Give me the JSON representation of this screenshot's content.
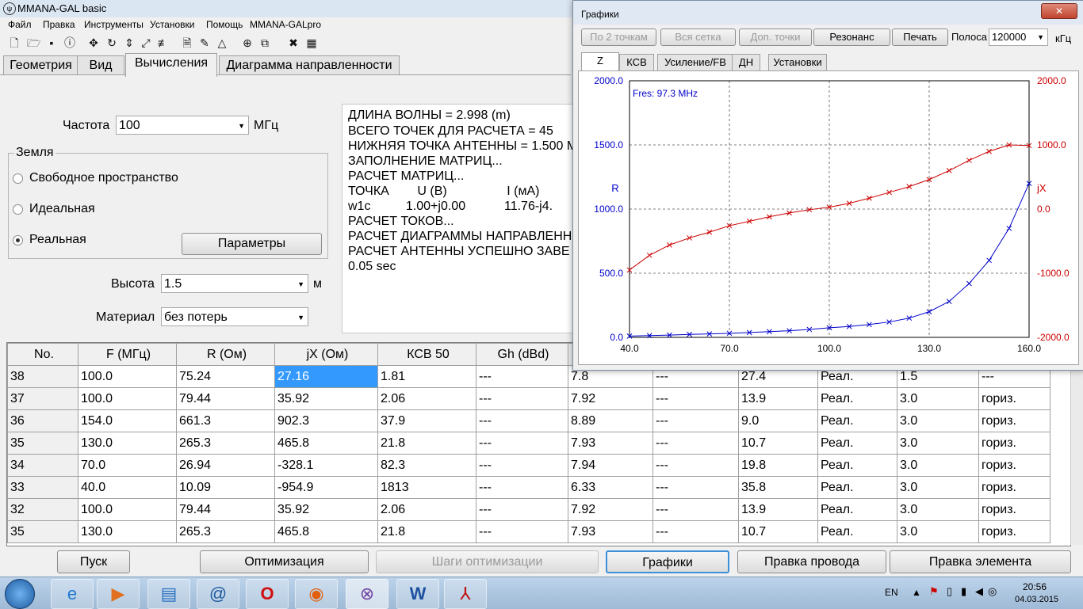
{
  "main_window": {
    "title": "MMANA-GAL basic",
    "menu": [
      "Файл",
      "Правка",
      "Инструменты",
      "Установки",
      "Помощь",
      "MMANA-GALpro"
    ],
    "tabs": [
      "Геометрия",
      "Вид",
      "Вычисления",
      "Диаграмма направленности"
    ],
    "active_tab": "Вычисления"
  },
  "form": {
    "freq_label": "Частота",
    "freq_value": "100",
    "freq_unit": "МГц",
    "ground_label": "Земля",
    "ground_options": [
      "Свободное пространство",
      "Идеальная",
      "Реальная"
    ],
    "ground_selected": "Реальная",
    "params_button": "Параметры",
    "height_label": "Высота",
    "height_value": "1.5",
    "height_unit": "м",
    "material_label": "Материал",
    "material_value": "без потерь"
  },
  "log_lines": [
    "ДЛИНА ВОЛНЫ = 2.998 (m)",
    "ВСЕГО ТОЧЕК ДЛЯ РАСЧЕТА = 45",
    "НИЖНЯЯ ТОЧКА АНТЕННЫ = 1.500 M",
    "ЗАПОЛНЕНИЕ МАТРИЦ...",
    "РАСЧЕТ МАТРИЦ...",
    "ТОЧКА        U (B)                 I (мА)",
    "w1c          1.00+j0.00           11.76-j4.",
    "РАСЧЕТ ТОКОВ...",
    "РАСЧЕТ ДИАГРАММЫ НАПРАВЛЕНН",
    "РАСЧЕТ АНТЕННЫ УСПЕШНО ЗАВЕ",
    "0.05 sec"
  ],
  "table": {
    "columns": [
      "No.",
      "F (МГц)",
      "R (Ом)",
      "jX (Ом)",
      "КСВ 50",
      "Gh (dBd)",
      "",
      "",
      "",
      "",
      "",
      ""
    ],
    "rows": [
      [
        "38",
        "100.0",
        "75.24",
        "27.16",
        "1.81",
        "---",
        "7.8",
        "---",
        "27.4",
        "Реал.",
        "1.5",
        "---"
      ],
      [
        "37",
        "100.0",
        "79.44",
        "35.92",
        "2.06",
        "---",
        "7.92",
        "---",
        "13.9",
        "Реал.",
        "3.0",
        "гориз."
      ],
      [
        "36",
        "154.0",
        "661.3",
        "902.3",
        "37.9",
        "---",
        "8.89",
        "---",
        "9.0",
        "Реал.",
        "3.0",
        "гориз."
      ],
      [
        "35",
        "130.0",
        "265.3",
        "465.8",
        "21.8",
        "---",
        "7.93",
        "---",
        "10.7",
        "Реал.",
        "3.0",
        "гориз."
      ],
      [
        "34",
        "70.0",
        "26.94",
        "-328.1",
        "82.3",
        "---",
        "7.94",
        "---",
        "19.8",
        "Реал.",
        "3.0",
        "гориз."
      ],
      [
        "33",
        "40.0",
        "10.09",
        "-954.9",
        "1813",
        "---",
        "6.33",
        "---",
        "35.8",
        "Реал.",
        "3.0",
        "гориз."
      ],
      [
        "32",
        "100.0",
        "79.44",
        "35.92",
        "2.06",
        "---",
        "7.92",
        "---",
        "13.9",
        "Реал.",
        "3.0",
        "гориз."
      ],
      [
        "35",
        "130.0",
        "265.3",
        "465.8",
        "21.8",
        "---",
        "7.93",
        "---",
        "10.7",
        "Реал.",
        "3.0",
        "гориз."
      ]
    ]
  },
  "bottom_buttons": [
    "Пуск",
    "Оптимизация",
    "Шаги оптимизации",
    "Графики",
    "Правка провода",
    "Правка элемента"
  ],
  "graph_window": {
    "title": "Графики",
    "close_glyph": "✕",
    "buttons": [
      "По 2 точкам",
      "Вся сетка",
      "Доп. точки",
      "Резонанс",
      "Печать"
    ],
    "band_label": "Полоса",
    "band_value": "120000",
    "band_unit": "кГц",
    "tabs": [
      "Z",
      "КСВ",
      "Усиление/FB",
      "ДН",
      "Установки"
    ],
    "active_tab": "Z"
  },
  "chart_data": {
    "type": "line",
    "annotation": "Fres: 97.3 MHz",
    "left_axis_label": "R",
    "right_axis_label": "jX",
    "x_ticks": [
      "40.0",
      "70.0",
      "100.0",
      "130.0",
      "160.0"
    ],
    "left_ticks": [
      "2000.0",
      "1500.0",
      "1000.0",
      "500.0",
      "0.0"
    ],
    "right_ticks": [
      "2000.0",
      "1000.0",
      "0.0",
      "-1000.0",
      "-2000.0"
    ],
    "xlim": [
      40,
      160
    ],
    "ylim_left": [
      0,
      2000
    ],
    "ylim_right": [
      -2000,
      2000
    ],
    "grid": true,
    "colors": {
      "R": "#0000cc",
      "jX": "#cc0000",
      "left_axis": "#0000cc",
      "right_axis": "#cc0000"
    },
    "series": [
      {
        "axis": "left",
        "color": "#0000cc",
        "x": [
          40,
          46,
          52,
          58,
          64,
          70,
          76,
          82,
          88,
          94,
          100,
          106,
          112,
          118,
          124,
          130,
          136,
          142,
          148,
          154,
          160
        ],
        "y": [
          10,
          14,
          18,
          23,
          27,
          32,
          38,
          45,
          52,
          62,
          75,
          85,
          100,
          120,
          150,
          200,
          280,
          420,
          600,
          850,
          1200
        ]
      },
      {
        "axis": "right",
        "color": "#cc0000",
        "x": [
          40,
          46,
          52,
          58,
          64,
          70,
          76,
          82,
          88,
          94,
          100,
          106,
          112,
          118,
          124,
          130,
          136,
          142,
          148,
          154,
          160
        ],
        "y": [
          -950,
          -720,
          -560,
          -450,
          -360,
          -260,
          -190,
          -120,
          -60,
          -10,
          30,
          90,
          170,
          260,
          350,
          460,
          600,
          760,
          900,
          1000,
          990
        ]
      }
    ]
  },
  "taskbar": {
    "lang": "EN",
    "time": "20:56",
    "date": "04.03.2015",
    "apps": [
      "start-orb",
      "ie",
      "media",
      "files",
      "mail",
      "opera",
      "firefox",
      "mmana",
      "word",
      "acrobat"
    ]
  }
}
